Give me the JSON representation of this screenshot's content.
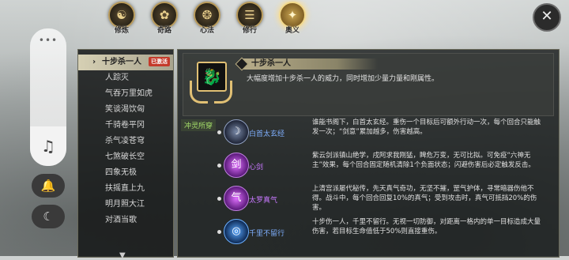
{
  "tabs": [
    {
      "label": "修炼",
      "glyph": "☯"
    },
    {
      "label": "奇路",
      "glyph": "✿"
    },
    {
      "label": "心法",
      "glyph": "❂"
    },
    {
      "label": "修行",
      "glyph": "☰"
    },
    {
      "label": "奥义",
      "glyph": "✦"
    }
  ],
  "controls": {
    "close_glyph": "✕",
    "more_glyph": "•••",
    "music_glyph": "♫",
    "bell_glyph": "🔔",
    "moon_glyph": "☾"
  },
  "skill_list": {
    "active_arrow": "›",
    "badge": "已激活",
    "items": [
      "十步杀一人",
      "人踪灭",
      "气吞万里如虎",
      "笑谈渴饮匈",
      "千骑卷平冈",
      "杀气凌苍穹",
      "七煞破长空",
      "四象无极",
      "扶摇直上九",
      "明月照大江",
      "对酒当歌"
    ],
    "scroll_glyph": "▼"
  },
  "detail": {
    "emblem_glyph": "🐉",
    "title": "十步杀一人",
    "description": "大幅度增加十步杀一人的威力，同时增加少量力量和刚属性。",
    "section_label": "冲灵所穿",
    "passives": [
      {
        "name": "白首太玄经",
        "glyph": "☽",
        "text": "谁能书阁下，白首太玄经。重伤一个目标后可额外行动一次，每个回合只能触发一次；“剑意”累加越多，伤害越高。"
      },
      {
        "name": "心剑",
        "glyph": "剑",
        "text": "紫云剑派镇山绝学，戌阿求我刚猛，睥危万变，无可比拟。可免疫“六神无主”效果，每个回合固定随机清除1个负面状态；闪避伤害后必定触发反击。"
      },
      {
        "name": "太罗真气",
        "glyph": "气",
        "text": "上清宫派屡代秘传，先天真气奇功，无坚不摧，罡气护体，寻常暗器伤他不得。战斗中，每个回合回复10%的真气；受到攻击时，真气可抵挡20%的伤害。"
      },
      {
        "name": "千里不留行",
        "glyph": "◎",
        "text": "十步伤一人，千里不留行。无视一切防御，对距离一格内的单一目标造成大量伤害，若目标生命值低于50%则直接重伤。"
      }
    ]
  }
}
